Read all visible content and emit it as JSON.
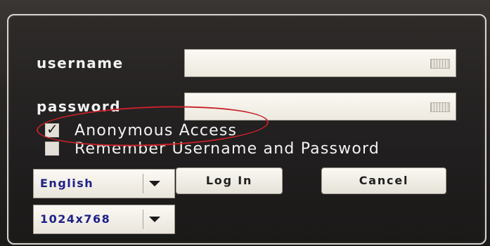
{
  "form": {
    "username_label": "username",
    "password_label": "password",
    "username_value": "",
    "password_value": ""
  },
  "options": {
    "anonymous_label": "Anonymous Access",
    "anonymous_checked": true,
    "remember_label": "Remember Username and Password",
    "remember_checked": false
  },
  "language": {
    "selected": "English"
  },
  "resolution": {
    "selected": "1024x768"
  },
  "buttons": {
    "login_label": "Log In",
    "cancel_label": "Cancel"
  },
  "colors": {
    "highlight_oval": "#c8212a",
    "select_text": "#1f1f8a"
  },
  "icons": {
    "field_icon": "keyboard-icon",
    "check_icon": "checkmark-icon",
    "dropdown_icon": "chevron-down-icon"
  }
}
